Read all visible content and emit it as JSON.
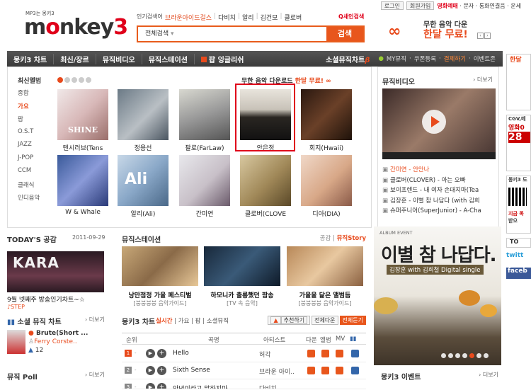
{
  "util": {
    "login": "로그인",
    "join": "회원가입",
    "links": [
      "영화예매",
      "문자",
      "통화연결음",
      "운세"
    ]
  },
  "logo": {
    "small": "MP3는 몽키3",
    "big_a": "m",
    "big_o": "o",
    "big_b": "nkey",
    "big_3": "3"
  },
  "popular": {
    "label": "인기검색어",
    "keywords": [
      "브라운아이드걸스",
      "다비치",
      "알리",
      "김건모",
      "클로버"
    ],
    "newsearch": "새인검색"
  },
  "search": {
    "category": "전체검색",
    "button": "검색",
    "placeholder": ""
  },
  "promo": {
    "line1": "무한 음악 다운",
    "line2": "한달 무료!",
    "inf": "∞"
  },
  "nav": {
    "items": [
      "몽키3 차트",
      "최신/장르",
      "뮤직비디오",
      "뮤직스테이션",
      "팝 잉글리쉬"
    ],
    "social": "소셜뮤직차트",
    "beta": "β",
    "right": [
      "MY뮤직",
      "쿠폰등록",
      "결제하기",
      "이벤트존"
    ]
  },
  "albums": {
    "heading": "최신앨범",
    "free_a": "무한 음악 다운로드 ",
    "free_b": "한달 무료!",
    "categories": [
      "종합",
      "가요",
      "팝",
      "O.S.T",
      "JAZZ",
      "J-POP",
      "CCM",
      "클래식",
      "인디음악"
    ],
    "active_category": "가요",
    "row1": [
      "텐시러브(Tens",
      "정용선",
      "팔로(FarLaw)",
      "안은정",
      "회지(Hwaii)"
    ],
    "row2": [
      "W & Whale",
      "알리(Ali)",
      "간미연",
      "클로버(CLOVE",
      "디아(DIA)"
    ]
  },
  "mv": {
    "heading": "뮤직비디오",
    "more": "› 더보기",
    "items": [
      "간미연 - 안안나",
      "클로버(CLOVER) - 아는 오빠",
      "보이프렌드 - 내 여자 손대지마(Tea",
      "김장훈 - 이별 참 나답다 (with 김희",
      "슈퍼주니어(SuperJunior) - A-Cha"
    ]
  },
  "side_ads": {
    "ad1": "한달",
    "ad2": "CGV,메",
    "ad2b": "영화0",
    "ad2c": "28",
    "ad3": "몽키3 도",
    "ad3b": "지금 목",
    "ad3c": "받으",
    "ad4": "TO",
    "ad5": "twitt",
    "ad6": "faceb"
  },
  "today": {
    "heading": "TODAY'S 공감",
    "date": "2011-09-29",
    "kara": "KARA",
    "title": "9월 넷째주 방송인기차트~☆",
    "sub": "♪STEP"
  },
  "social": {
    "heading": "소셜 뮤직 차트",
    "more": "› 더보기",
    "song": "Brute(Short ...",
    "artist": "Ferry Corste..",
    "count": "12"
  },
  "poll": {
    "heading": "뮤직 Poll",
    "more": "› 더보기"
  },
  "station": {
    "heading": "뮤직스테이션",
    "link1": "공감",
    "link2": "뮤직Story",
    "cards": [
      {
        "t1": "낭만점정 가을 페스티벌",
        "t2": "[붕붕붕붕 음악가이드]"
      },
      {
        "t1": "하모니카 출룡했던 팜송",
        "t2": "[TV 속 음악]"
      },
      {
        "t1": "가을을 닮은 앨범듬",
        "t2": "[붕붕붕붕 음악가이드]"
      }
    ]
  },
  "chart": {
    "heading": "몽키3 차트",
    "tabs": [
      "실시간",
      "가요",
      "팝",
      "소셜뮤직"
    ],
    "buttons": [
      "추천하기",
      "전체다운",
      "전체듣기"
    ],
    "cols": {
      "rank": "순위",
      "song": "곡명",
      "artist": "아티스트",
      "down": "다운",
      "album": "앨범",
      "mv": "MV"
    },
    "rows": [
      {
        "rank": "1",
        "move": "-",
        "song": "Hello",
        "artist": "허각"
      },
      {
        "rank": "2",
        "move": "-",
        "song": "Sixth Sense",
        "artist": "브라운 아이.."
      },
      {
        "rank": "3",
        "move": "-",
        "song": "안녕이라고 말하지마",
        "artist": "다비치"
      }
    ]
  },
  "event": {
    "label": "ALBUM EVENT",
    "title": "이별 참 나답다.",
    "sub": "김장훈 with 김희철 Digital single"
  },
  "mk_event": {
    "heading": "몽키3 이벤트",
    "more": "› 더보기"
  }
}
